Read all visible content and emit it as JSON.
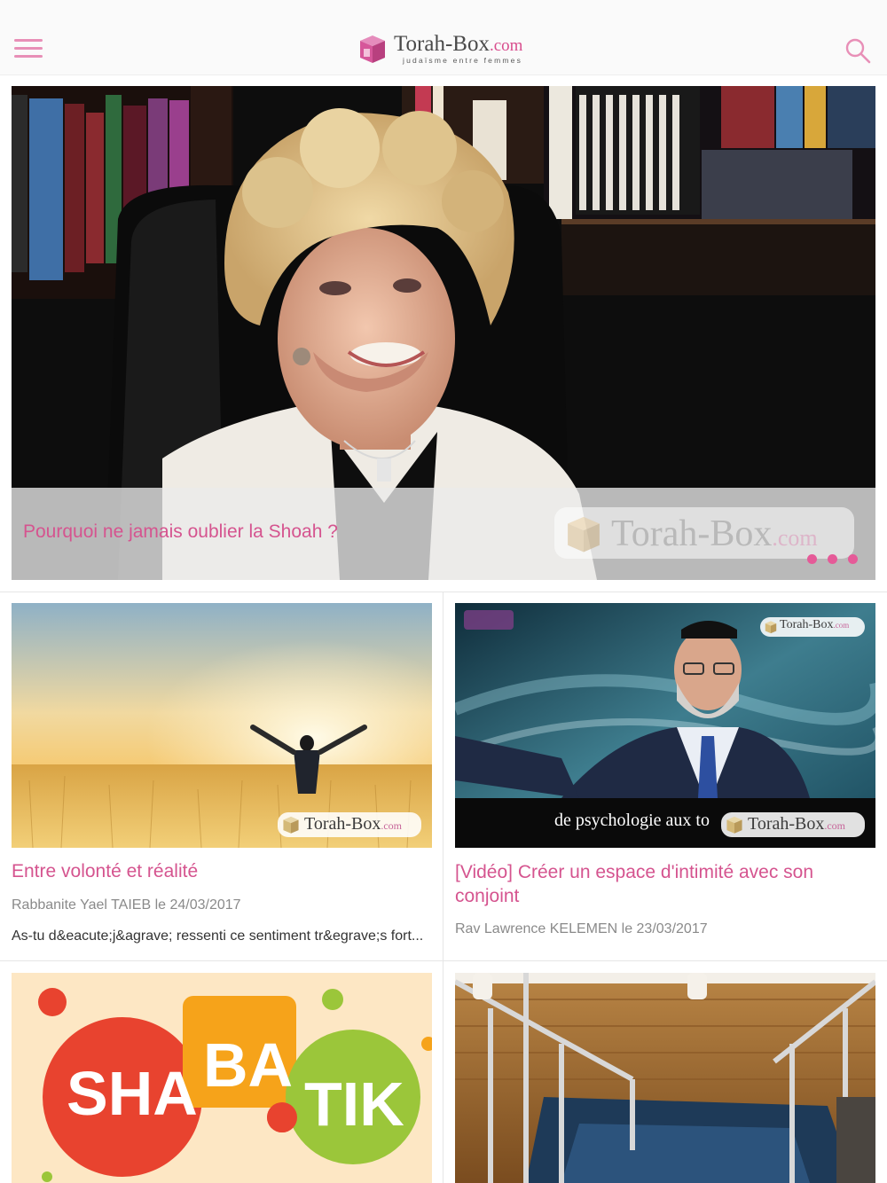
{
  "header": {
    "logo_name": "Torah-Box",
    "logo_domain": ".com",
    "logo_tagline": "judaïsme entre femmes",
    "menu_icon": "hamburger-icon",
    "search_icon": "search-icon",
    "accent_color": "#d5548f"
  },
  "hero": {
    "title": "Pourquoi ne jamais oublier la Shoah ?",
    "watermark": "Torah-Box",
    "watermark_domain": ".com",
    "pager_count": 3
  },
  "articles": [
    {
      "title": "Entre volonté et réalité",
      "meta": "Rabbanite Yael TAIEB le 24/03/2017",
      "excerpt": "As-tu d&eacute;j&agrave; ressenti ce sentiment tr&egrave;s fort...",
      "badge": "Torah-Box",
      "badge_domain": ".com"
    },
    {
      "title": "[Vidéo] Créer un espace d'intimité avec son conjoint",
      "meta": "Rav Lawrence KELEMEN le 23/03/2017",
      "video_caption": "de psychologie aux to",
      "badge": "Torah-Box",
      "badge_domain": ".com"
    },
    {
      "logo_letters": [
        "SHA",
        "BA",
        "TIK"
      ]
    },
    {}
  ]
}
